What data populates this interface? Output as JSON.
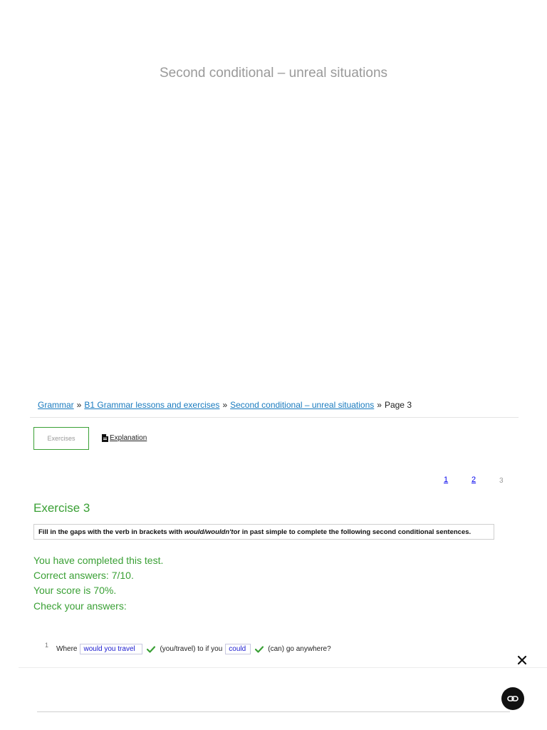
{
  "page": {
    "title": "Second conditional – unreal situations"
  },
  "breadcrumb": {
    "items": [
      {
        "label": "Grammar",
        "link": true
      },
      {
        "label": "B1 Grammar lessons and exercises",
        "link": true
      },
      {
        "label": "Second conditional – unreal situations",
        "link": true
      },
      {
        "label": "Page 3",
        "link": false
      }
    ],
    "separator": "»"
  },
  "tabs": {
    "exercises": "Exercises",
    "explanation": "Explanation"
  },
  "pagination": {
    "pages": [
      "1",
      "2",
      "3"
    ],
    "current": "3"
  },
  "exercise": {
    "title": "Exercise 3",
    "instructions_before": "Fill in the gaps with the verb in brackets with ",
    "instructions_em": "would/wouldn't",
    "instructions_after": " or in past simple to complete the following second conditional sentences."
  },
  "result": {
    "completed": "You have completed this test.",
    "correct": "Correct answers: 7/10.",
    "score": "Your score is 70%.",
    "check": "Check your answers:"
  },
  "questions": [
    {
      "number": "1",
      "before": "Where",
      "answer1": "would you travel",
      "hint1": "(you/travel) to if you",
      "answer2": "could",
      "hint2": "(can) go anywhere?"
    }
  ],
  "icons": {
    "explanation": "document-icon",
    "correct": "check-icon",
    "close": "close-icon",
    "fab": "link-icon"
  },
  "colors": {
    "accent_green": "#3aa035",
    "link_blue": "#1a7bbf",
    "answer_blue": "#1a1ad0",
    "title_gray": "#9a9a9a"
  }
}
